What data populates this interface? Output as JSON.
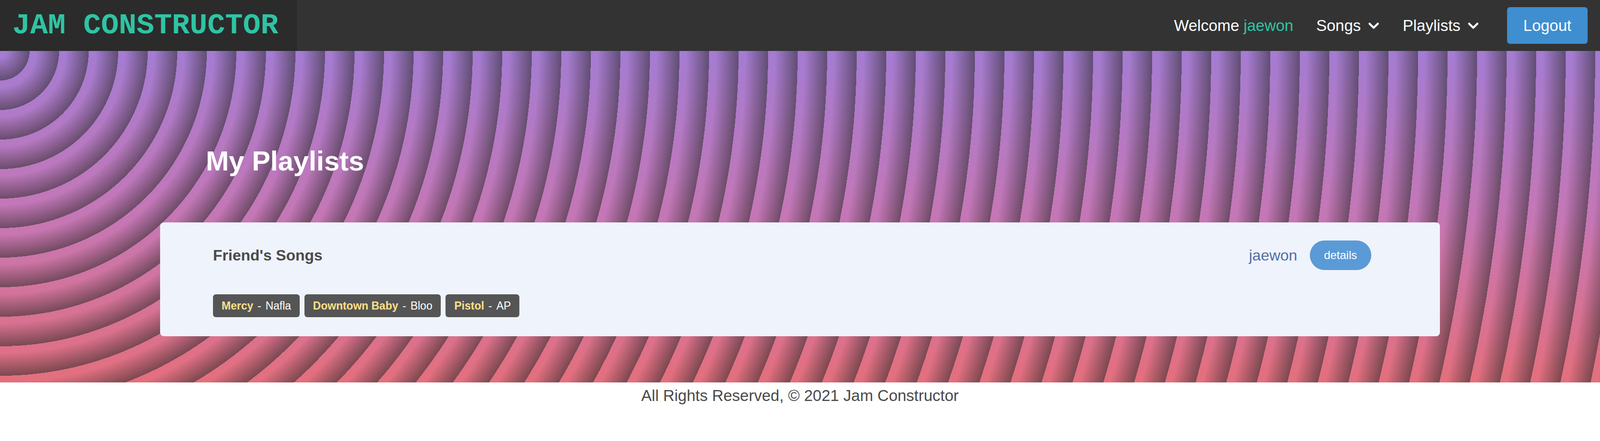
{
  "brand": "JAM CONSTRUCTOR",
  "nav": {
    "welcome": "Welcome",
    "user": "jaewon",
    "menus": [
      "Songs",
      "Playlists"
    ],
    "logout": "Logout"
  },
  "page_title": "My Playlists",
  "playlists": [
    {
      "name": "Friend's Songs",
      "owner": "jaewon",
      "action": "details",
      "separator": "-",
      "songs": [
        {
          "title": "Mercy",
          "artist": "Nafla"
        },
        {
          "title": "Downtown Baby",
          "artist": "Bloo"
        },
        {
          "title": "Pistol",
          "artist": "AP"
        }
      ]
    }
  ],
  "footer": "All Rights Reserved, © 2021 Jam Constructor"
}
